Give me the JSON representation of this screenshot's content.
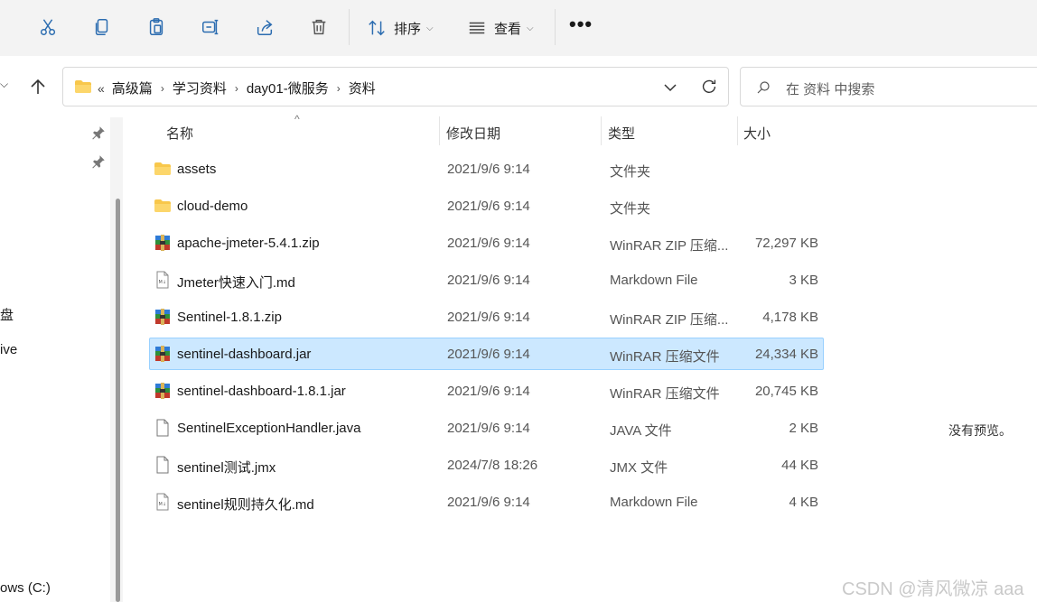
{
  "toolbar": {
    "sort_label": "排序",
    "view_label": "查看",
    "more_label": "•••"
  },
  "address": {
    "crumbs": [
      "高级篇",
      "学习资料",
      "day01-微服务",
      "资料"
    ],
    "overflow": "«"
  },
  "search": {
    "placeholder": "在 资料 中搜索"
  },
  "leftnav": {
    "items": [
      "盘",
      "ive",
      "ows (C:)"
    ]
  },
  "columns": {
    "name": "名称",
    "date": "修改日期",
    "type": "类型",
    "size": "大小"
  },
  "files": [
    {
      "name": "assets",
      "date": "2021/9/6 9:14",
      "type": "文件夹",
      "size": "",
      "icon": "folder-icon"
    },
    {
      "name": "cloud-demo",
      "date": "2021/9/6 9:14",
      "type": "文件夹",
      "size": "",
      "icon": "folder-icon"
    },
    {
      "name": "apache-jmeter-5.4.1.zip",
      "date": "2021/9/6 9:14",
      "type": "WinRAR ZIP 压缩...",
      "size": "72,297 KB",
      "icon": "winrar-icon"
    },
    {
      "name": "Jmeter快速入门.md",
      "date": "2021/9/6 9:14",
      "type": "Markdown File",
      "size": "3 KB",
      "icon": "markdown-file-icon"
    },
    {
      "name": "Sentinel-1.8.1.zip",
      "date": "2021/9/6 9:14",
      "type": "WinRAR ZIP 压缩...",
      "size": "4,178 KB",
      "icon": "winrar-icon"
    },
    {
      "name": "sentinel-dashboard.jar",
      "date": "2021/9/6 9:14",
      "type": "WinRAR 压缩文件",
      "size": "24,334 KB",
      "icon": "winrar-icon",
      "selected": true
    },
    {
      "name": "sentinel-dashboard-1.8.1.jar",
      "date": "2021/9/6 9:14",
      "type": "WinRAR 压缩文件",
      "size": "20,745 KB",
      "icon": "winrar-icon"
    },
    {
      "name": "SentinelExceptionHandler.java",
      "date": "2021/9/6 9:14",
      "type": "JAVA 文件",
      "size": "2 KB",
      "icon": "file-icon"
    },
    {
      "name": "sentinel测试.jmx",
      "date": "2024/7/8 18:26",
      "type": "JMX 文件",
      "size": "44 KB",
      "icon": "file-icon"
    },
    {
      "name": "sentinel规则持久化.md",
      "date": "2021/9/6 9:14",
      "type": "Markdown File",
      "size": "4 KB",
      "icon": "markdown-file-icon"
    }
  ],
  "preview": {
    "message": "没有预览。"
  },
  "watermark": "CSDN @清风微凉 aaa",
  "colors": {
    "selection_bg": "#cce8ff",
    "selection_border": "#99d1ff",
    "folder": "#f8c74b",
    "toolbar_bg": "#f3f3f3"
  }
}
